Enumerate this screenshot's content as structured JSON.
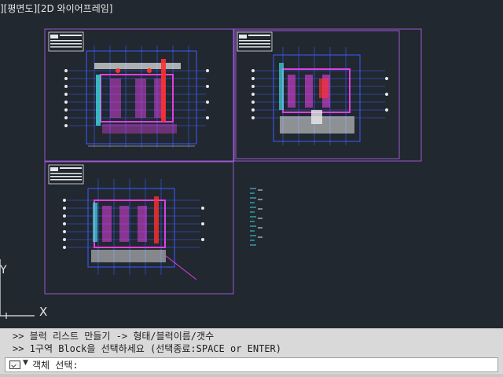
{
  "viewport": {
    "label": "][평면도][2D 와이어프레임]",
    "axis_y": "Y",
    "axis_x": "X"
  },
  "command_line": {
    "history": [
      ">> 블럭 리스트 만들기 -> 형태/블럭이름/갯수",
      ">> 1구역 Block을 선택하세요 (선택종료:SPACE or ENTER)"
    ],
    "prompt": "객체 선택:",
    "dropdown_glyph": "▼"
  },
  "colors": {
    "background": "#212830",
    "viewport_frame": "#9b59d0",
    "drawing_blue": "#3c5cff",
    "drawing_magenta": "#e040e0",
    "drawing_red": "#ff3030",
    "drawing_white": "#e8e8e8",
    "drawing_cyan": "#40d8e0",
    "command_bg": "#d9d9d9"
  }
}
